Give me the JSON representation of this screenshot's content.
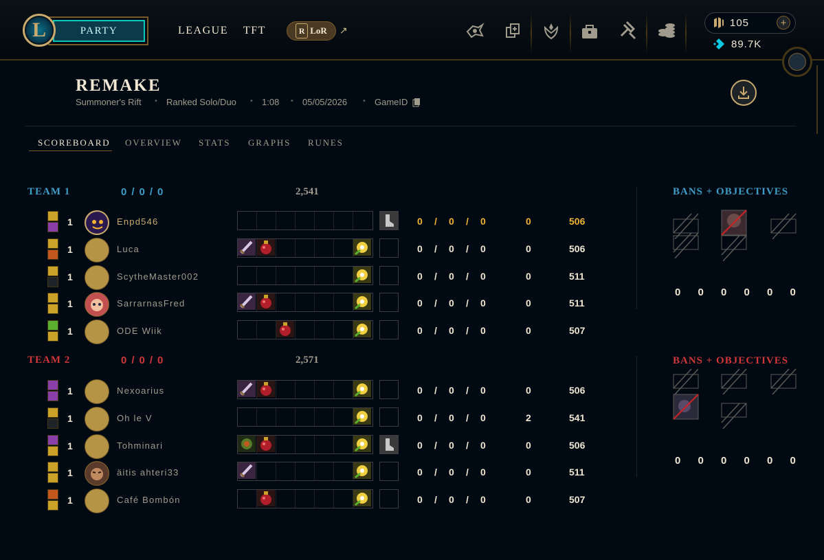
{
  "topbar": {
    "party_label": "PARTY",
    "nav": [
      "LEAGUE",
      "TFT"
    ],
    "lor_label": "LoR",
    "lor_r": "R",
    "ext_glyph": "↗",
    "icons": [
      "voice-chat-icon",
      "collection-icon",
      "profile-rank-icon",
      "store-icon",
      "loot-icon",
      "currency-icon"
    ],
    "rp": "105",
    "be": "89.7K",
    "plus": "+",
    "colors": {
      "gold": "#c8aa6e",
      "teal": "#0ac8b9",
      "blue_essence": "#0acbe6"
    }
  },
  "match": {
    "title": "REMAKE",
    "map": "Summoner's Rift",
    "queue": "Ranked Solo/Duo",
    "duration": "1:08",
    "date": "05/05/2026",
    "game_id_label": "GameID"
  },
  "tabs": [
    "SCOREBOARD",
    "OVERVIEW",
    "STATS",
    "GRAPHS",
    "RUNES"
  ],
  "team1": {
    "label": "TEAM 1",
    "kda": [
      "0",
      "/",
      "0",
      "/",
      "0"
    ],
    "gold": "2,541",
    "color": "#3e9cc6",
    "objectives_title": "BANS + OBJECTIVES",
    "objective_counts": [
      "0",
      "0",
      "0",
      "0",
      "0",
      "0"
    ],
    "players": [
      {
        "name": "Enpd546",
        "level": "1",
        "kda": [
          "0",
          "/",
          "0",
          "/",
          "0"
        ],
        "cs": "0",
        "gold": "506",
        "is_me": true
      },
      {
        "name": "Luca",
        "level": "1",
        "kda": [
          "0",
          "/",
          "0",
          "/",
          "0"
        ],
        "cs": "0",
        "gold": "506"
      },
      {
        "name": "ScytheMaster002",
        "level": "1",
        "kda": [
          "0",
          "/",
          "0",
          "/",
          "0"
        ],
        "cs": "0",
        "gold": "511"
      },
      {
        "name": "SarrarnasFred",
        "level": "1",
        "kda": [
          "0",
          "/",
          "0",
          "/",
          "0"
        ],
        "cs": "0",
        "gold": "511"
      },
      {
        "name": "ODE Wiik",
        "level": "1",
        "kda": [
          "0",
          "/",
          "0",
          "/",
          "0"
        ],
        "cs": "0",
        "gold": "507"
      }
    ]
  },
  "team2": {
    "label": "TEAM 2",
    "kda": [
      "0",
      "/",
      "0",
      "/",
      "0"
    ],
    "gold": "2,571",
    "color": "#d13639",
    "objectives_title": "BANS + OBJECTIVES",
    "objective_counts": [
      "0",
      "0",
      "0",
      "0",
      "0",
      "0"
    ],
    "players": [
      {
        "name": "Nexoarius",
        "level": "1",
        "kda": [
          "0",
          "/",
          "0",
          "/",
          "0"
        ],
        "cs": "0",
        "gold": "506"
      },
      {
        "name": "Oh le V",
        "level": "1",
        "kda": [
          "0",
          "/",
          "0",
          "/",
          "0"
        ],
        "cs": "2",
        "gold": "541"
      },
      {
        "name": "Tohminari",
        "level": "1",
        "kda": [
          "0",
          "/",
          "0",
          "/",
          "0"
        ],
        "cs": "0",
        "gold": "506"
      },
      {
        "name": "äitis ahteri33",
        "level": "1",
        "kda": [
          "0",
          "/",
          "0",
          "/",
          "0"
        ],
        "cs": "0",
        "gold": "511"
      },
      {
        "name": "Café Bombón",
        "level": "1",
        "kda": [
          "0",
          "/",
          "0",
          "/",
          "0"
        ],
        "cs": "0",
        "gold": "507"
      }
    ]
  }
}
